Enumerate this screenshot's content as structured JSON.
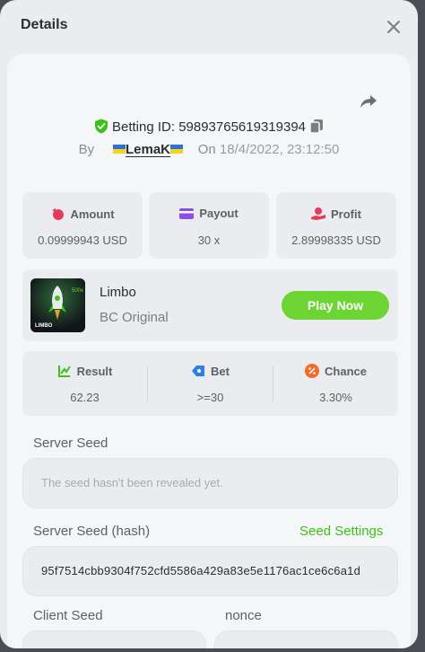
{
  "modal": {
    "title": "Details",
    "close_icon": "close-icon"
  },
  "bet": {
    "id_label": "Betting ID:",
    "id_value": "598937656193193​94",
    "by_label": "By",
    "username": "LemaK",
    "on_label": "On",
    "date": "18/4/2022, 23:12:50"
  },
  "stats": [
    {
      "label": "Amount",
      "value": "0.09999943 USD",
      "icon": "coin-bag-icon",
      "color": "#e8395b"
    },
    {
      "label": "Payout",
      "value": "30 x",
      "icon": "wallet-card-icon",
      "color": "#8b4ee8"
    },
    {
      "label": "Profit",
      "value": "2.89998335 USD",
      "icon": "hand-coins-icon",
      "color": "#e8395b"
    }
  ],
  "game": {
    "name": "Limbo",
    "subtitle": "BC Original",
    "play_label": "Play Now",
    "thumb_text": "LIMBO",
    "thumb_badge": "500x"
  },
  "result": [
    {
      "label": "Result",
      "value": "62.23",
      "icon": "result-chart-icon",
      "color": "#3bc117"
    },
    {
      "label": "Bet",
      "value": ">=30",
      "icon": "bet-tag-icon",
      "color": "#2f7ee8"
    },
    {
      "label": "Chance",
      "value": "3.30%",
      "icon": "percent-icon",
      "color": "#f06a2a"
    }
  ],
  "seeds": {
    "server_seed_label": "Server Seed",
    "server_seed_placeholder": "The seed hasn't been revealed yet.",
    "server_hash_label": "Server Seed (hash)",
    "seed_settings_label": "Seed Settings",
    "server_hash_value": "95f7514cbb9304f752cfd5586a429a83e5e1176ac1ce6c6a1d",
    "client_seed_label": "Client Seed",
    "nonce_label": "nonce"
  },
  "colors": {
    "accent_green": "#6cd533",
    "link_green": "#3bc117",
    "verified_green": "#3bc117"
  }
}
